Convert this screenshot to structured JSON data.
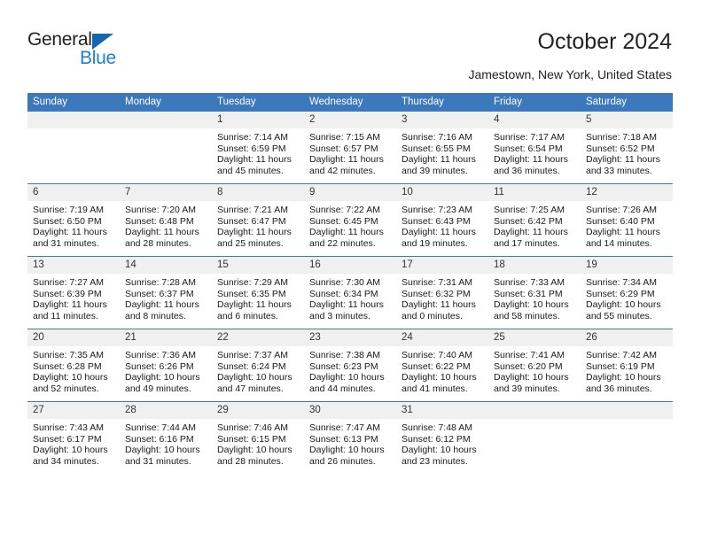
{
  "logo": {
    "word1": "General",
    "word2": "Blue",
    "triangle_color": "#1565b0",
    "blue_text_color": "#1b7fd4"
  },
  "header": {
    "title": "October 2024",
    "subtitle": "Jamestown, New York, United States"
  },
  "theme": {
    "header_bg": "#3b78bc",
    "daynum_bg": "#f0f0f0",
    "grid_line": "#3b78bc"
  },
  "calendar": {
    "weekday_headers": [
      "Sunday",
      "Monday",
      "Tuesday",
      "Wednesday",
      "Thursday",
      "Friday",
      "Saturday"
    ],
    "weeks": [
      [
        {
          "day": "",
          "empty": true
        },
        {
          "day": "",
          "empty": true
        },
        {
          "day": "1",
          "sunrise": "Sunrise: 7:14 AM",
          "sunset": "Sunset: 6:59 PM",
          "daylight": "Daylight: 11 hours and 45 minutes."
        },
        {
          "day": "2",
          "sunrise": "Sunrise: 7:15 AM",
          "sunset": "Sunset: 6:57 PM",
          "daylight": "Daylight: 11 hours and 42 minutes."
        },
        {
          "day": "3",
          "sunrise": "Sunrise: 7:16 AM",
          "sunset": "Sunset: 6:55 PM",
          "daylight": "Daylight: 11 hours and 39 minutes."
        },
        {
          "day": "4",
          "sunrise": "Sunrise: 7:17 AM",
          "sunset": "Sunset: 6:54 PM",
          "daylight": "Daylight: 11 hours and 36 minutes."
        },
        {
          "day": "5",
          "sunrise": "Sunrise: 7:18 AM",
          "sunset": "Sunset: 6:52 PM",
          "daylight": "Daylight: 11 hours and 33 minutes."
        }
      ],
      [
        {
          "day": "6",
          "sunrise": "Sunrise: 7:19 AM",
          "sunset": "Sunset: 6:50 PM",
          "daylight": "Daylight: 11 hours and 31 minutes."
        },
        {
          "day": "7",
          "sunrise": "Sunrise: 7:20 AM",
          "sunset": "Sunset: 6:48 PM",
          "daylight": "Daylight: 11 hours and 28 minutes."
        },
        {
          "day": "8",
          "sunrise": "Sunrise: 7:21 AM",
          "sunset": "Sunset: 6:47 PM",
          "daylight": "Daylight: 11 hours and 25 minutes."
        },
        {
          "day": "9",
          "sunrise": "Sunrise: 7:22 AM",
          "sunset": "Sunset: 6:45 PM",
          "daylight": "Daylight: 11 hours and 22 minutes."
        },
        {
          "day": "10",
          "sunrise": "Sunrise: 7:23 AM",
          "sunset": "Sunset: 6:43 PM",
          "daylight": "Daylight: 11 hours and 19 minutes."
        },
        {
          "day": "11",
          "sunrise": "Sunrise: 7:25 AM",
          "sunset": "Sunset: 6:42 PM",
          "daylight": "Daylight: 11 hours and 17 minutes."
        },
        {
          "day": "12",
          "sunrise": "Sunrise: 7:26 AM",
          "sunset": "Sunset: 6:40 PM",
          "daylight": "Daylight: 11 hours and 14 minutes."
        }
      ],
      [
        {
          "day": "13",
          "sunrise": "Sunrise: 7:27 AM",
          "sunset": "Sunset: 6:39 PM",
          "daylight": "Daylight: 11 hours and 11 minutes."
        },
        {
          "day": "14",
          "sunrise": "Sunrise: 7:28 AM",
          "sunset": "Sunset: 6:37 PM",
          "daylight": "Daylight: 11 hours and 8 minutes."
        },
        {
          "day": "15",
          "sunrise": "Sunrise: 7:29 AM",
          "sunset": "Sunset: 6:35 PM",
          "daylight": "Daylight: 11 hours and 6 minutes."
        },
        {
          "day": "16",
          "sunrise": "Sunrise: 7:30 AM",
          "sunset": "Sunset: 6:34 PM",
          "daylight": "Daylight: 11 hours and 3 minutes."
        },
        {
          "day": "17",
          "sunrise": "Sunrise: 7:31 AM",
          "sunset": "Sunset: 6:32 PM",
          "daylight": "Daylight: 11 hours and 0 minutes."
        },
        {
          "day": "18",
          "sunrise": "Sunrise: 7:33 AM",
          "sunset": "Sunset: 6:31 PM",
          "daylight": "Daylight: 10 hours and 58 minutes."
        },
        {
          "day": "19",
          "sunrise": "Sunrise: 7:34 AM",
          "sunset": "Sunset: 6:29 PM",
          "daylight": "Daylight: 10 hours and 55 minutes."
        }
      ],
      [
        {
          "day": "20",
          "sunrise": "Sunrise: 7:35 AM",
          "sunset": "Sunset: 6:28 PM",
          "daylight": "Daylight: 10 hours and 52 minutes."
        },
        {
          "day": "21",
          "sunrise": "Sunrise: 7:36 AM",
          "sunset": "Sunset: 6:26 PM",
          "daylight": "Daylight: 10 hours and 49 minutes."
        },
        {
          "day": "22",
          "sunrise": "Sunrise: 7:37 AM",
          "sunset": "Sunset: 6:24 PM",
          "daylight": "Daylight: 10 hours and 47 minutes."
        },
        {
          "day": "23",
          "sunrise": "Sunrise: 7:38 AM",
          "sunset": "Sunset: 6:23 PM",
          "daylight": "Daylight: 10 hours and 44 minutes."
        },
        {
          "day": "24",
          "sunrise": "Sunrise: 7:40 AM",
          "sunset": "Sunset: 6:22 PM",
          "daylight": "Daylight: 10 hours and 41 minutes."
        },
        {
          "day": "25",
          "sunrise": "Sunrise: 7:41 AM",
          "sunset": "Sunset: 6:20 PM",
          "daylight": "Daylight: 10 hours and 39 minutes."
        },
        {
          "day": "26",
          "sunrise": "Sunrise: 7:42 AM",
          "sunset": "Sunset: 6:19 PM",
          "daylight": "Daylight: 10 hours and 36 minutes."
        }
      ],
      [
        {
          "day": "27",
          "sunrise": "Sunrise: 7:43 AM",
          "sunset": "Sunset: 6:17 PM",
          "daylight": "Daylight: 10 hours and 34 minutes."
        },
        {
          "day": "28",
          "sunrise": "Sunrise: 7:44 AM",
          "sunset": "Sunset: 6:16 PM",
          "daylight": "Daylight: 10 hours and 31 minutes."
        },
        {
          "day": "29",
          "sunrise": "Sunrise: 7:46 AM",
          "sunset": "Sunset: 6:15 PM",
          "daylight": "Daylight: 10 hours and 28 minutes."
        },
        {
          "day": "30",
          "sunrise": "Sunrise: 7:47 AM",
          "sunset": "Sunset: 6:13 PM",
          "daylight": "Daylight: 10 hours and 26 minutes."
        },
        {
          "day": "31",
          "sunrise": "Sunrise: 7:48 AM",
          "sunset": "Sunset: 6:12 PM",
          "daylight": "Daylight: 10 hours and 23 minutes."
        },
        {
          "day": "",
          "empty": true
        },
        {
          "day": "",
          "empty": true
        }
      ]
    ]
  }
}
